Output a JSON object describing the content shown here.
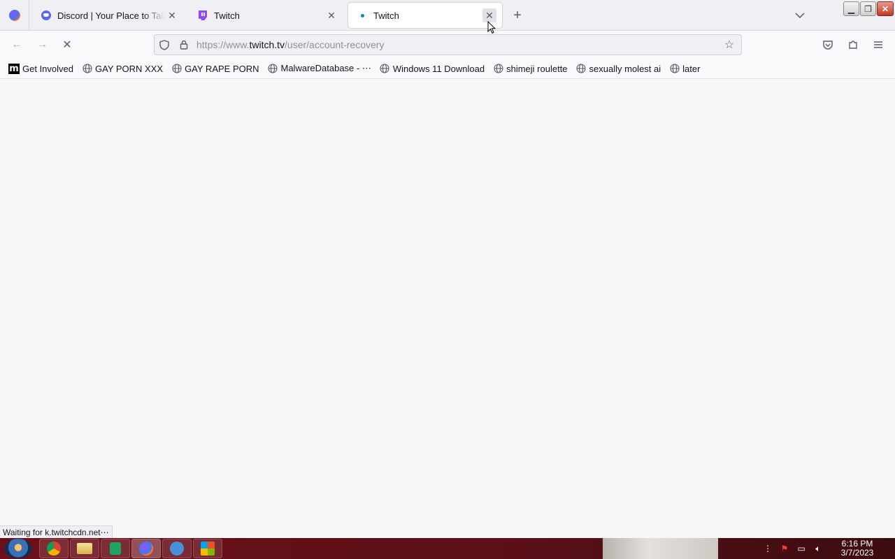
{
  "tabs": [
    {
      "title": "Discord | Your Place to Talk and Hang Out",
      "icon": "discord-icon",
      "active": false
    },
    {
      "title": "Twitch",
      "icon": "twitch-icon",
      "active": false
    },
    {
      "title": "Twitch",
      "icon": "loading-dot-icon",
      "active": true
    }
  ],
  "url": {
    "scheme": "https://www.",
    "host": "twitch.tv",
    "path": "/user/account-recovery"
  },
  "bookmarks": [
    {
      "label": "Get Involved",
      "icon": "m-logo-icon"
    },
    {
      "label": "GAY PORN XXX",
      "icon": "globe-icon"
    },
    {
      "label": "GAY RAPE PORN",
      "icon": "globe-icon"
    },
    {
      "label": "MalwareDatabase - ⋯",
      "icon": "globe-icon"
    },
    {
      "label": "Windows 11 Download",
      "icon": "globe-icon"
    },
    {
      "label": "shimeji roulette",
      "icon": "globe-icon"
    },
    {
      "label": "sexually molest ai",
      "icon": "globe-icon"
    },
    {
      "label": "later",
      "icon": "globe-icon"
    }
  ],
  "status": "Waiting for k.twitchcdn.net⋯",
  "clock": {
    "time": "6:16 PM",
    "date": "3/7/2023"
  },
  "colors": {
    "twitch": "#9146ff",
    "discord": "#5865f2",
    "taskbar": "#6d0f18"
  }
}
